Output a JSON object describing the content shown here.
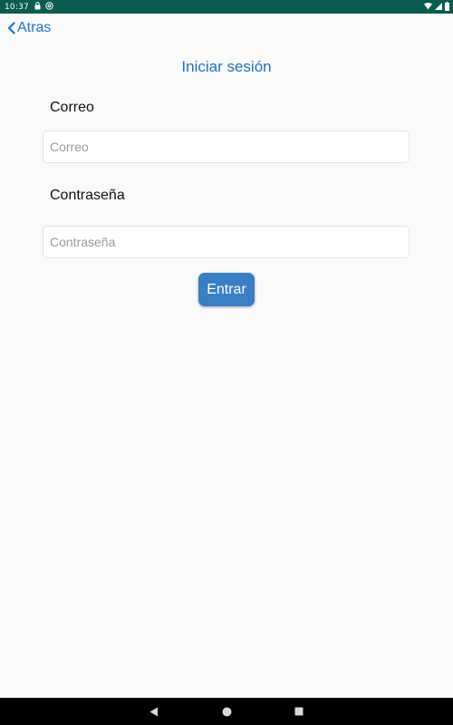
{
  "status_bar": {
    "time": "10:37",
    "notification_icons": [
      "lock-icon",
      "at-sign-icon"
    ],
    "system_icons": [
      "wifi-icon",
      "signal-icon",
      "battery-icon"
    ],
    "background_color": "#0a5c4f"
  },
  "header": {
    "back_label": "Atras",
    "back_icon": "chevron-left-icon",
    "title": "Iniciar sesión"
  },
  "form": {
    "email": {
      "label": "Correo",
      "placeholder": "Correo",
      "value": ""
    },
    "password": {
      "label": "Contraseña",
      "placeholder": "Contraseña",
      "value": ""
    },
    "submit_label": "Entrar"
  },
  "nav_bar": {
    "icons": [
      "nav-back-icon",
      "nav-home-icon",
      "nav-recents-icon"
    ]
  },
  "colors": {
    "accent": "#1976d2",
    "button": "#3a7fc4",
    "background": "#fafafa"
  }
}
